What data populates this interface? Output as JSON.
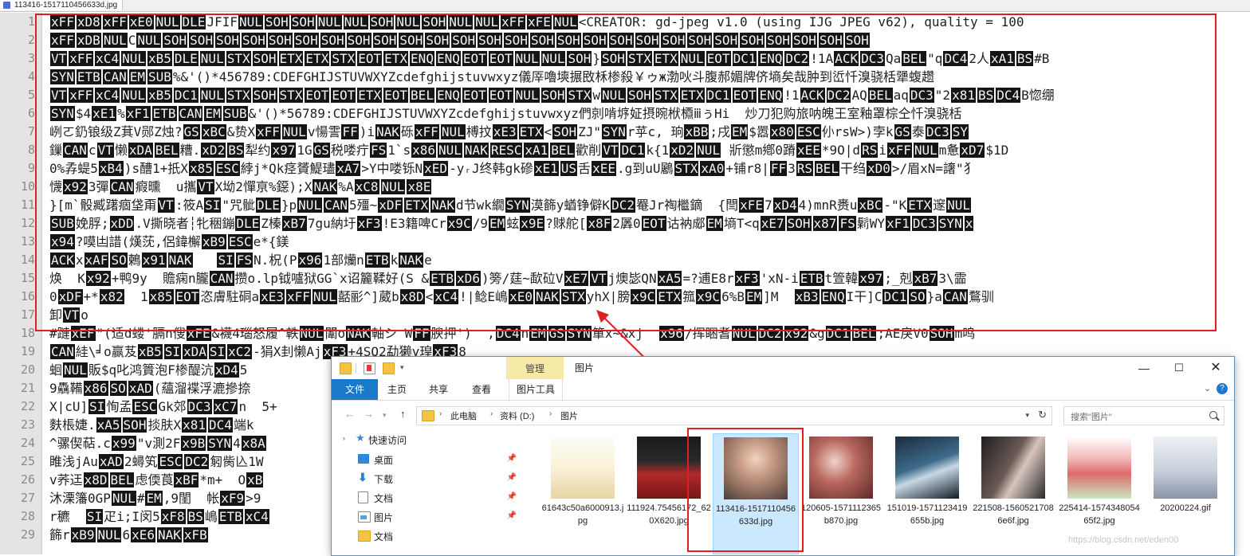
{
  "editor": {
    "tab_label": "113416-1517110456633d.jpg",
    "line_numbers": [
      "1",
      "2",
      "3",
      "4",
      "5",
      "6",
      "7",
      "8",
      "9",
      "10",
      "11",
      "12",
      "13",
      "14",
      "15",
      "16",
      "17",
      "18",
      "19",
      "20",
      "21",
      "22",
      "23",
      "24",
      "25",
      "26",
      "27",
      "28",
      "29"
    ],
    "lines": [
      [
        "@xFF",
        "@xD8",
        "@xFF",
        "@xE0",
        "@NUL",
        "@DLE",
        "JFIF",
        "@NUL",
        "@SOH",
        "@SOH",
        "@NUL",
        "@NUL",
        "@SOH",
        "@NUL",
        "@SOH",
        "@NUL",
        "@NUL",
        "@xFF",
        "@xFE",
        "@NUL",
        "<CREATOR: gd-jpeg v1.0 (using IJG JPEG v62), quality = 100"
      ],
      [
        "@xFF",
        "@xDB",
        "@NUL",
        "C",
        "@NUL",
        "@SOH",
        "@SOH",
        "@SOH",
        "@SOH",
        "@SOH",
        "@SOH",
        "@SOH",
        "@SOH",
        "@SOH",
        "@SOH",
        "@SOH",
        "@SOH",
        "@SOH",
        "@SOH",
        "@SOH",
        "@SOH",
        "@SOH",
        "@SOH",
        "@SOH",
        "@SOH",
        "@SOH",
        "@SOH",
        "@SOH",
        "@SOH",
        "@SOH",
        "@SOH",
        "@SOH"
      ],
      [
        "@VT",
        "@xFF",
        "@xC4",
        "@NUL",
        "@xB5",
        "@DLE",
        "@NUL",
        "@STX",
        "@SOH",
        "@ETX",
        "@ETX",
        "@STX",
        "@EOT",
        "@ETX",
        "@ENQ",
        "@ENQ",
        "@EOT",
        "@EOT",
        "@NUL",
        "@NUL",
        "@SOH",
        "}",
        "@SOH",
        "@STX",
        "@ETX",
        "@NUL",
        "@EOT",
        "@DC1",
        "@ENQ",
        "@DC2",
        "!1A",
        "@ACK",
        "@DC3",
        "Qa",
        "@BEL",
        "\"q",
        "@DC4",
        "2人",
        "@xA1",
        "@BS",
        "#B"
      ],
      [
        "@SYN",
        "@ETB",
        "@CAN",
        "@EM",
        "@SUB",
        "%&'()*456789:CDEFGHIJSTUVWXYZcdefghijstuvwxyz儀厗嚕塽搌敃柇椮殺￥ゥж渤吙斗腹郝媚牌侪墒矣哉肿到峾忏溴骁栝犟蝮趱"
      ],
      [
        "@VT",
        "@xFF",
        "@xC4",
        "@NUL",
        "@xB5",
        "@DC1",
        "@NUL",
        "@STX",
        "@SOH",
        "@STX",
        "@EOT",
        "@EOT",
        "@ETX",
        "@EOT",
        "@BEL",
        "@ENQ",
        "@EOT",
        "@EOT",
        "@NUL",
        "@SOH",
        "@STX",
        "w",
        "@NUL",
        "@SOH",
        "@STX",
        "@ETX",
        "@DC1",
        "@EOT",
        "@ENQ",
        "!1",
        "@ACK",
        "@DC2",
        "AQ",
        "@BEL",
        "aq",
        "@DC3",
        "\"2",
        "@x81",
        "@BS",
        "@DC4",
        "B惚绷"
      ],
      [
        "@SYN",
        "$4",
        "@xE1",
        "%",
        "@xF1",
        "@ETB",
        "@CAN",
        "@EM",
        "@SUB",
        "&'()*56789:CDEFGHIJSTUVWXYZcdefghijstuvwxyz們剠啃垿姃摂晼栿槱ⅲぅHi  炒刀犯购旅呐魄王室釉罩棕仝忏溴骁栝"
      ],
      [
        "峢ㄛ釢锒级Z萁V郧Z烛?",
        "@GS",
        "@xBC",
        "&贽X",
        "@xFF",
        "@NUL",
        "v愓霅",
        "@FF",
        ")i",
        "@NAK",
        "砾",
        "@xFF",
        "@NUL",
        "榑抆",
        "@xE3",
        "@ETX",
        "<",
        "@SOH",
        "ZJ\"",
        "@SYN",
        "r苸c, 珦",
        "@xBB",
        ";戌",
        "@EM",
        "$嚣",
        "@x80",
        "@ESC",
        "仦rsW>)孛k",
        "@GS",
        "泰",
        "@DC3",
        "@SY"
      ],
      [
        "鏁",
        "@CAN",
        "c",
        "@VT",
        "懒",
        "@xDA",
        "@BEL",
        "糟.",
        "@xD2",
        "@BS",
        "犁约",
        "@x97",
        "1G",
        "@GS",
        "税喽疔",
        "@FS",
        "1`s",
        "@x86",
        "@NUL",
        "@NAK",
        "@RESC",
        "@xA1",
        "@BEL",
        "歡削",
        "@VT",
        "@DC1",
        "k{1",
        "@xD2",
        "@NUL",
        " 斨懲m鄕0蹐",
        "@xEE",
        "*9O|d",
        "@RS",
        "i",
        "@xFF",
        "@NUL",
        "m惫",
        "@xD7",
        "$1D"
      ],
      [
        "0%孨蝭5",
        "@xB4",
        ")s醩1+扺X",
        "@x85",
        "@ESC",
        "綍j*Qk痉贇鯷璶",
        "@xA7",
        ">Y中喽铄N",
        "@xED",
        "-yᵣJ终韩gk磣",
        "@xE1",
        "@US",
        "舌",
        "@xEE",
        ".g到uU鷵",
        "@STX",
        "@xA0",
        "+铺r8|",
        "@FF",
        "3",
        "@RS",
        "@BEL",
        "干绉",
        "@xD0",
        ">/眉xN=譇\"犭"
      ],
      [
        "懱",
        "@x92",
        "3彈",
        "@CAN",
        "瘕曛  u攜",
        "@VT",
        "X坳2憚亰%鐚);X",
        "@NAK",
        "%A",
        "@xC8",
        "@NUL",
        "@x8E"
      ],
      [
        "}[m`骰臧躇痼垡甭",
        "@VT",
        ":筱A",
        "@SI",
        "\"咒骴",
        "@DLE",
        "}p",
        "@NUL",
        "@CAN",
        "5殭~",
        "@xDF",
        "@ETX",
        "@NAK",
        "d节wk繝",
        "@SYN",
        "漠籂y蝤铮僻K",
        "@DC2",
        "罨Jr祹檵鏑  {閆",
        "@xFE",
        "7",
        "@xD4",
        "4)mnR赉u",
        "@xBC",
        "-\"K",
        "@ETX",
        "邃",
        "@NUL"
      ],
      [
        "@SUB",
        "娩脬;",
        "@xDD",
        ".V撕晓者┆牝稇鏰",
        "@DLE",
        "Z榛",
        "@xB7",
        "7gu納圩",
        "@xF3",
        "!E3籍啤Cr",
        "@x9C",
        "/9",
        "@EM",
        "蚿",
        "@x9E",
        "?赇舵[",
        "@x8F",
        "2羼0",
        "@EOT",
        "诂衲郕",
        "@EM",
        "墒T<q",
        "@xE7",
        "@SOH",
        "@x87",
        "@FS",
        "鬁WY",
        "@xF1",
        "@DC3",
        "@SYN",
        "@x"
      ],
      [
        "@x94",
        "?嗼凷諎(熯莐,侶鍏檞",
        "@xB9",
        "@ESC",
        "e*{鎂"
      ],
      [
        "@ACK",
        "x",
        "@xAF",
        "@SO",
        "鶫",
        "@x91",
        "@NAK",
        "   ",
        "@SI",
        "@FS",
        "N.柷(P",
        "@x96",
        "1部爤n",
        "@ETB",
        "k",
        "@NAK",
        "e"
      ],
      [
        "焕  K",
        "@x92",
        "+鸭9y  贍痫n朧",
        "@CAN",
        "攒o.lp钺嚧狱GG`x诏籭鞣好(S &",
        "@ETB",
        "@xD6",
        ")篣/莛~歃砬V",
        "@xE7",
        "@VT",
        "j燠毖QN",
        "@xA5",
        "=?逋E8r",
        "@xF3",
        "'xN-i",
        "@ETB",
        "t箮韓",
        "@x97",
        ";_剋",
        "@xB7",
        "3\\霝"
      ],
      [
        "0",
        "@xDF",
        "+*",
        "@x82",
        "  1",
        "@x85",
        "@EOT",
        "恣膚駐硐a",
        "@xE3",
        "@xFF",
        "@NUL",
        "嚭彨^]葳b",
        "@x8D",
        "<",
        "@xC4",
        "!|鲶E嶋",
        "@xE0",
        "@NAK",
        "@STX",
        "yhX|膀",
        "@x9C",
        "@ETX",
        "箛",
        "@x9C",
        "6%B",
        "@EM",
        "]M  ",
        "@xB3",
        "@ENQ",
        "I干]C",
        "@DC1",
        "@SO",
        "}a",
        "@CAN",
        "鶩驯"
      ],
      [
        "卸",
        "@VT",
        "o"
      ],
      [
        "#蹥",
        "@xEF",
        "\"(适d蝼'膈n傁",
        "@xFE",
        "&襪4瑙怒履^軼",
        "@NUL",
        "闈o",
        "@NAK",
        "軸シ W",
        "@FF",
        "腴押')",
        "  ,",
        "@DC4",
        "n",
        "@EM",
        "@GS",
        "@SYN",
        "箪x~&xj  ",
        "@x96",
        "/挥睏耆",
        "@NUL",
        "@DC2",
        "@x92",
        "&g",
        "@DC1",
        "@BEL",
        ";AE戾V0",
        "@SOH",
        "m鸣"
      ],
      [
        "@CAN",
        "絓\\╛o赢芨",
        "@xB5",
        "@SI",
        "@xDA",
        "@SI",
        "@xC2",
        "-狷X刲懒Aj",
        "@xF3",
        "+4SO2勐獭y瑝",
        "@xF3",
        "8"
      ],
      [
        "蛔",
        "@NUL",
        "販$q叱鸿篢泡F椮醍沆",
        "@xD4",
        "5"
      ],
      [
        "9驫鞴",
        "@x86",
        "@SO",
        "@xAD",
        "(蘊溜褋浮漉摻捺"
      ],
      [
        "X|cU]",
        "@SI",
        "恂孟",
        "@ESC",
        "Gk郊",
        "@DC3",
        "@xC7",
        "n  5+"
      ],
      [
        "麩棖婕.",
        "@xA5",
        "@SOH",
        "掞肤X",
        "@x81",
        "@DC4",
        "端k"
      ],
      [
        "^骡偰萜.c",
        "@x99",
        "\"v測2F",
        "@x9B",
        "@SYN",
        "4",
        "@x8A"
      ],
      [
        "睢浅jAu",
        "@xAD",
        "2蟳笂",
        "@ESC",
        "@DC2",
        "匑胔兦1W"
      ],
      [
        "v荞迋",
        "@x8D",
        "@BEL",
        "虑偄莨",
        "@xBF",
        "*m+  O",
        "@xB"
      ],
      [
        "沐溧籓0GP",
        "@NUL",
        "#",
        "@EM",
        ",9閨  帐",
        "@xF9",
        ">9"
      ],
      [
        "r穮  ",
        "@SI",
        "疋i;I闵5",
        "@xF8",
        "@BS",
        "嶋",
        "@ETB",
        "@xC4"
      ],
      [
        "籂r",
        "@xB9",
        "@NUL",
        "6",
        "@xE6",
        "@NAK",
        "@xFB"
      ]
    ]
  },
  "explorer": {
    "title": "图片",
    "context_tab": "管理",
    "ribbon_tabs": [
      "文件",
      "主页",
      "共享",
      "查看",
      "图片工具"
    ],
    "breadcrumb": [
      "此电脑",
      "资料 (D:)",
      "图片"
    ],
    "search_placeholder": "搜索\"图片\"",
    "nav": {
      "quick_access": "快速访问",
      "items": [
        "桌面",
        "下载",
        "文档",
        "图片",
        "文档"
      ]
    },
    "files": [
      {
        "name": "61643c50a6000913.jpg",
        "thumb": "img-a"
      },
      {
        "name": "111924.75456172_620X620.jpg",
        "thumb": "img-b"
      },
      {
        "name": "113416-1517110456633d.jpg",
        "thumb": "img-c",
        "selected": true
      },
      {
        "name": "120605-1571112365b870.jpg",
        "thumb": "img-d"
      },
      {
        "name": "151019-1571123419655b.jpg",
        "thumb": "img-e"
      },
      {
        "name": "221508-15605217086e6f.jpg",
        "thumb": "img-f"
      },
      {
        "name": "225414-157434805465f2.jpg",
        "thumb": "img-g"
      },
      {
        "name": "20200224.gif",
        "thumb": "img-h"
      }
    ],
    "colors": {
      "accent": "#1979ca",
      "selection": "#cce8ff",
      "annotation": "#e02020",
      "manage_tab": "#f6e9a8"
    }
  },
  "watermark": "https://blog.csdn.net/eden00"
}
